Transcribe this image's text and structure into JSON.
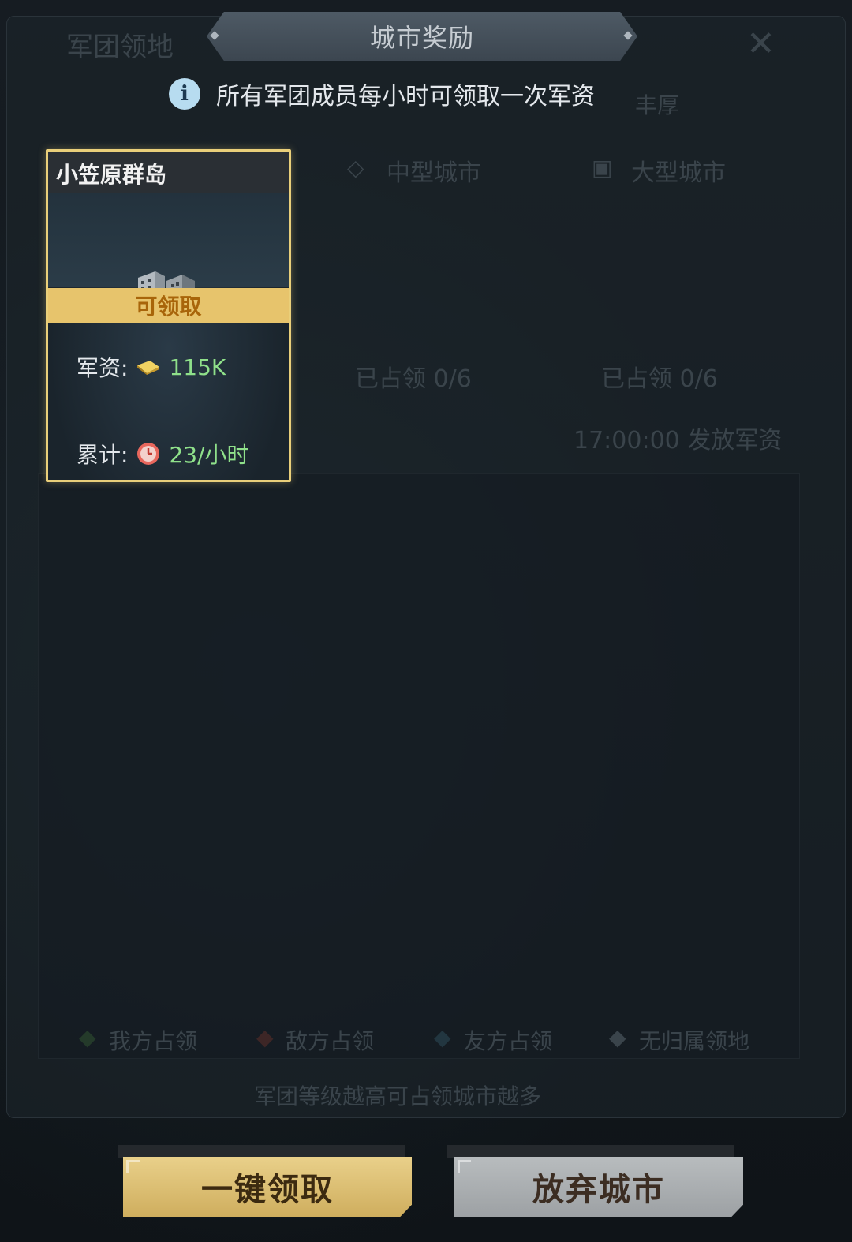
{
  "background": {
    "title": "军团领地",
    "tip_tail": "丰厚",
    "tab_medium": "中型城市",
    "tab_large": "大型城市",
    "occupied_medium": "已占领 0/6",
    "occupied_large": "已占领 0/6",
    "release_time": "17:00:00 发放军资",
    "legend_own": "我方占领",
    "legend_enemy": "敌方占领",
    "legend_ally": "友方占领",
    "legend_none": "无归属领地",
    "footer_tip": "军团等级越高可占领城市越多"
  },
  "dialog": {
    "title": "城市奖励",
    "info": "所有军团成员每小时可领取一次军资"
  },
  "city_card": {
    "name": "小笠原群岛",
    "status": "可领取",
    "supply_label": "军资:",
    "supply_value": "115K",
    "accumulate_label": "累计:",
    "accumulate_value": "23/小时"
  },
  "buttons": {
    "claim_all": "一键领取",
    "abandon_city": "放弃城市"
  },
  "colors": {
    "card_border": "#e9cf7a",
    "claim_strip": "#e7c46c",
    "value_green": "#8fe08a",
    "claim_button": "#d9bd70",
    "abandon_button": "#aeb2b4"
  }
}
